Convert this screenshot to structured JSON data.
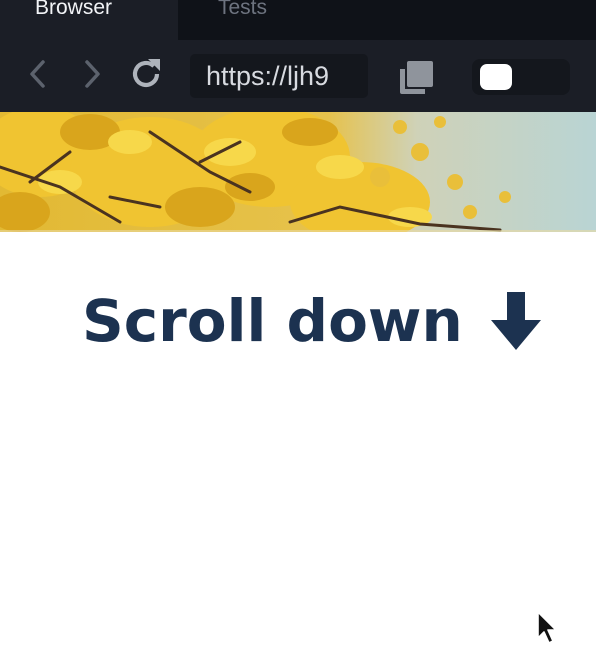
{
  "tabs": [
    {
      "label": "Browser",
      "active": true
    },
    {
      "label": "Tests",
      "active": false
    }
  ],
  "toolbar": {
    "back_icon": "chevron-left-icon",
    "forward_icon": "chevron-right-icon",
    "reload_icon": "reload-icon",
    "url_value": "https://ljh9",
    "copy_icon": "copy-icon",
    "toggle_state": "off"
  },
  "hero": {
    "image": "yellow ginkgo leaves against pale sky"
  },
  "page": {
    "headline": "Scroll down",
    "headline_icon": "arrow-down-icon",
    "headline_color": "#1c3250"
  },
  "colors": {
    "tabbar_bg": "#0f1218",
    "toolbar_bg": "#1b1e26",
    "field_bg": "#14171d"
  }
}
